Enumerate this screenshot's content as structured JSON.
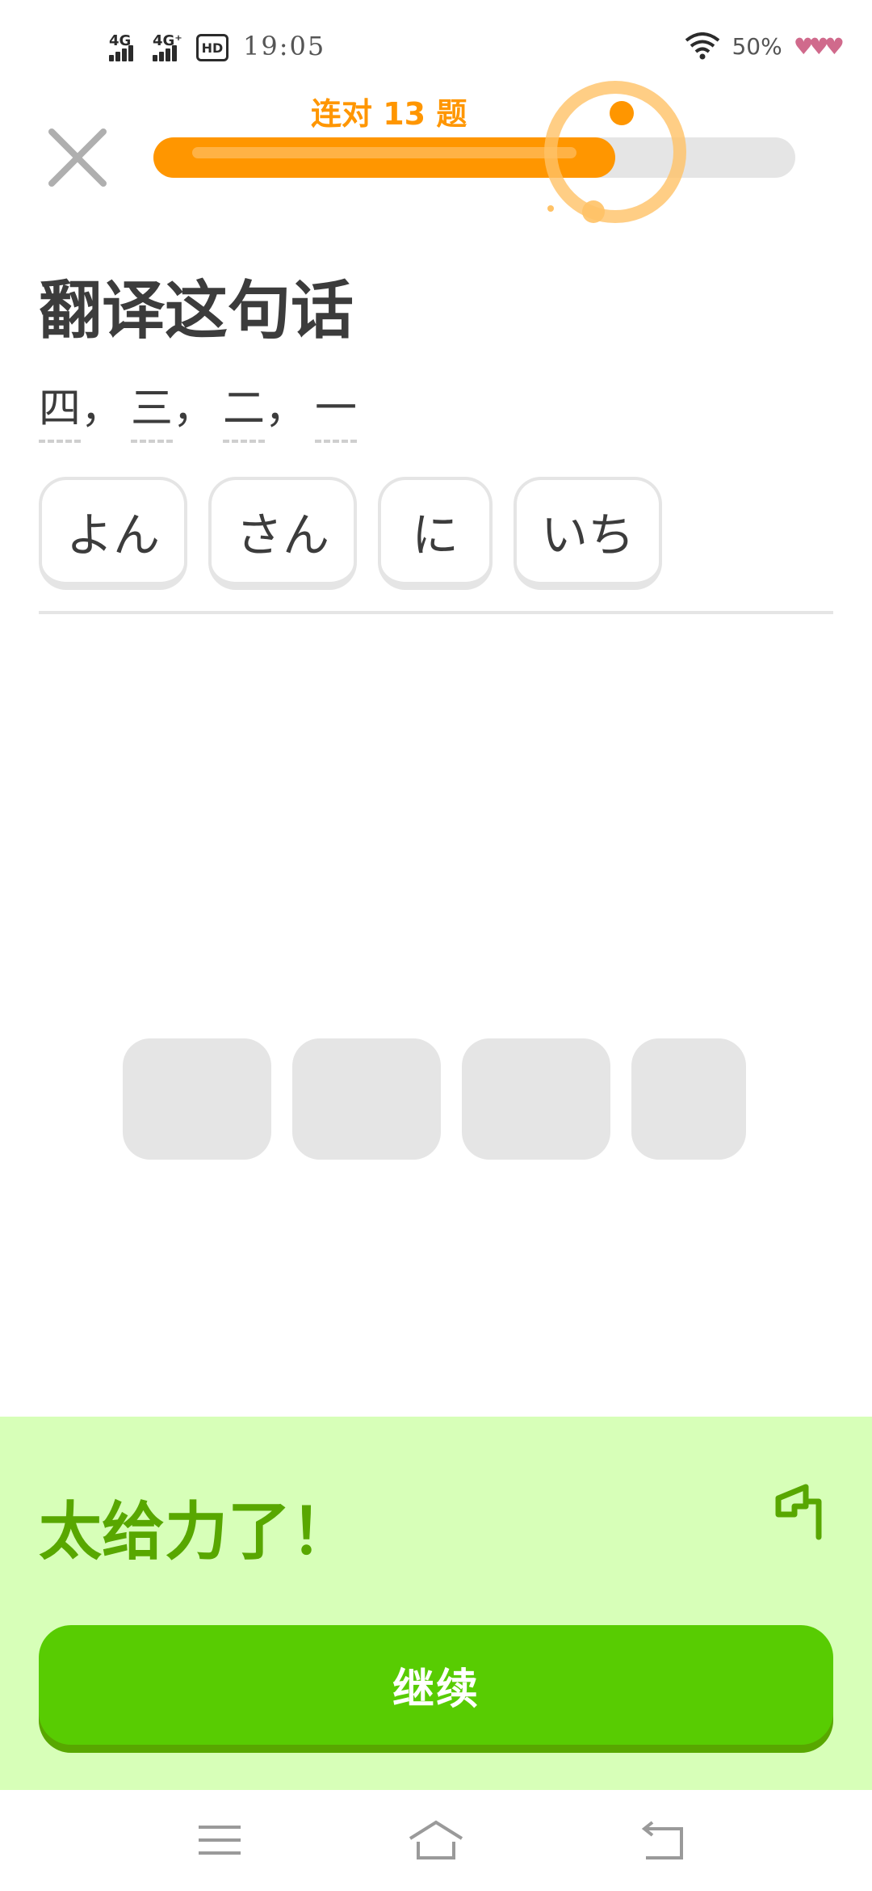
{
  "status_bar": {
    "network_1": "4G",
    "network_2": "4G⁺",
    "hd_badge": "HD",
    "time": "19:05",
    "battery": "50%"
  },
  "header": {
    "streak_label": "连对 13 题",
    "progress_fraction": 0.72
  },
  "prompt": {
    "title": "翻译这句话",
    "sentence": [
      {
        "word": "四",
        "punct": "，"
      },
      {
        "word": "三",
        "punct": "，"
      },
      {
        "word": "二",
        "punct": "，"
      },
      {
        "word": "一",
        "punct": ""
      }
    ]
  },
  "answer": {
    "chips": [
      "よん",
      "さん",
      "に",
      "いち"
    ]
  },
  "word_bank": {
    "slot_count": 4
  },
  "feedback": {
    "title": "太给力了！",
    "continue_label": "继续"
  },
  "colors": {
    "accent_orange": "#ff9600",
    "success_green": "#58cc02",
    "success_green_dark": "#58a700",
    "feedback_bg": "#d7ffb8",
    "neutral_gray": "#e5e5e5"
  },
  "icons": {
    "close": "close-icon",
    "report": "flag-icon",
    "nav_menu": "menu-icon",
    "nav_home": "home-icon",
    "nav_back": "back-icon"
  }
}
